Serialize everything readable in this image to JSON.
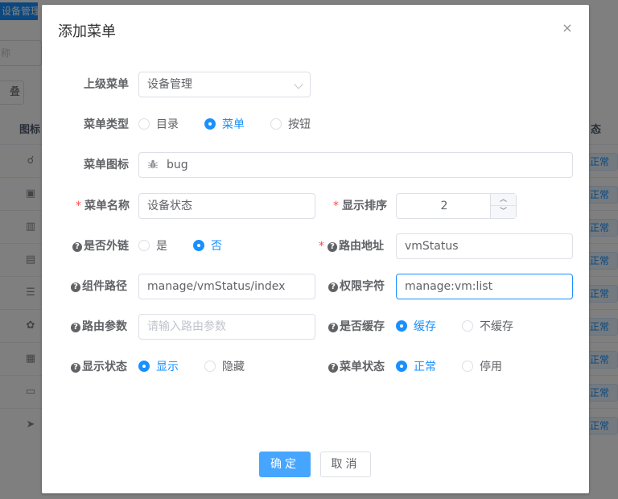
{
  "background": {
    "tab_label": "设备管理",
    "tab_close": "×",
    "search_hint": "称",
    "expand_button": "叠",
    "col_icon": "图标",
    "col_status": "态",
    "row_status_tag": "正常",
    "row_icons": [
      "bug-icon",
      "monitor-icon",
      "book-icon",
      "report-icon",
      "list-icon",
      "gear-icon",
      "chart-icon",
      "toolbox-icon",
      "send-icon"
    ]
  },
  "dialog": {
    "title": "添加菜单",
    "close_symbol": "×",
    "fields": {
      "parent": {
        "label": "上级菜单",
        "value": "设备管理"
      },
      "menu_type": {
        "label": "菜单类型",
        "options": [
          "目录",
          "菜单",
          "按钮"
        ],
        "selected": "菜单"
      },
      "icon": {
        "label": "菜单图标",
        "value": "bug"
      },
      "name": {
        "label": "菜单名称",
        "value": "设备状态"
      },
      "order": {
        "label": "显示排序",
        "value": "2"
      },
      "external": {
        "label": "是否外链",
        "options": [
          "是",
          "否"
        ],
        "selected": "否"
      },
      "route_path": {
        "label": "路由地址",
        "value": "vmStatus"
      },
      "component": {
        "label": "组件路径",
        "value": "manage/vmStatus/index"
      },
      "permission": {
        "label": "权限字符",
        "value": "manage:vm:list"
      },
      "route_query": {
        "label": "路由参数",
        "placeholder": "请输入路由参数",
        "value": ""
      },
      "cache": {
        "label": "是否缓存",
        "options": [
          "缓存",
          "不缓存"
        ],
        "selected": "缓存"
      },
      "visible": {
        "label": "显示状态",
        "options": [
          "显示",
          "隐藏"
        ],
        "selected": "显示"
      },
      "status": {
        "label": "菜单状态",
        "options": [
          "正常",
          "停用"
        ],
        "selected": "正常"
      }
    },
    "buttons": {
      "confirm": "确定",
      "cancel": "取消"
    }
  },
  "colors": {
    "primary": "#1890ff",
    "button_primary": "#46a6ff",
    "required": "#ff4949"
  }
}
